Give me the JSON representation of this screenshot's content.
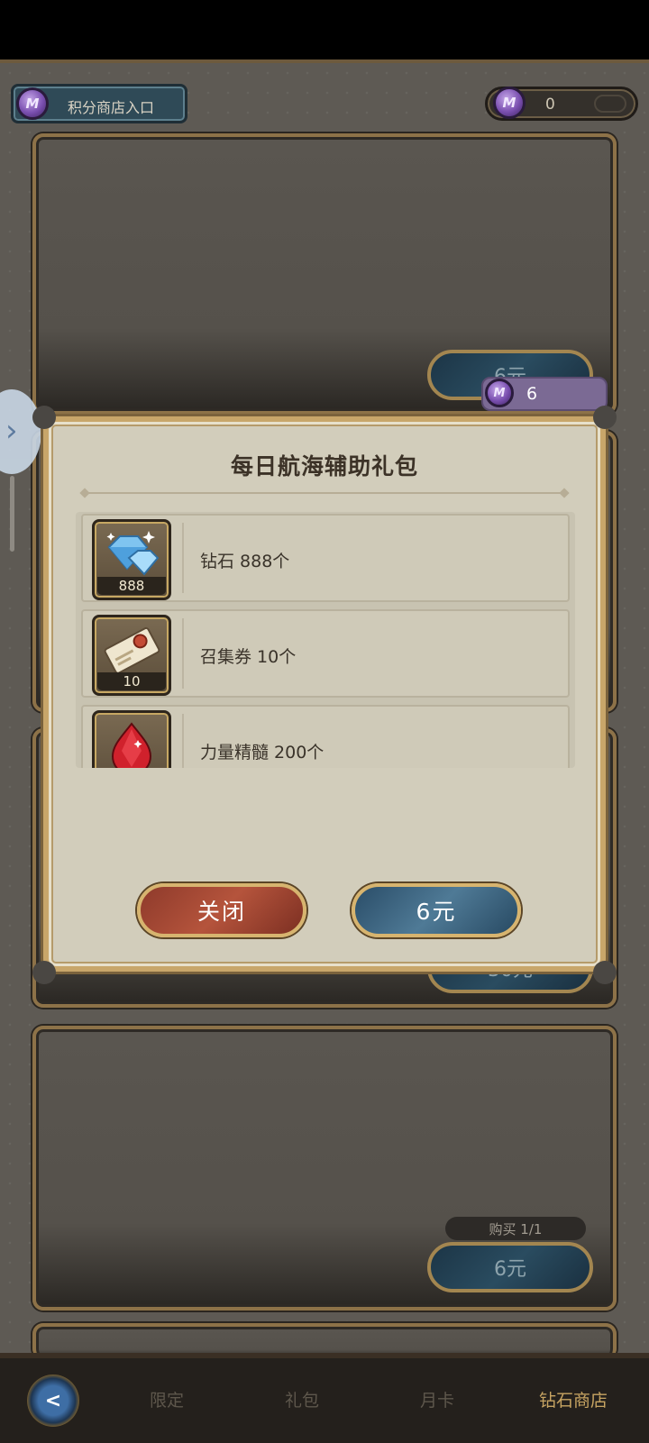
{
  "header": {
    "shop_entry_label": "积分商店入口",
    "coin_symbol": "M",
    "currency_amount": "0"
  },
  "background_cards": [
    {
      "price": "6元"
    },
    {
      "price": "30元"
    },
    {
      "purchase_limit": "购买 1/1",
      "price": "6元"
    }
  ],
  "vip_badge": {
    "value": "6"
  },
  "modal": {
    "title": "每日航海辅助礼包",
    "rewards": [
      {
        "icon": "diamond-icon",
        "qty": "888",
        "name": "钻石 888个"
      },
      {
        "icon": "summon-ticket-icon",
        "qty": "10",
        "name": "召集券 10个"
      },
      {
        "icon": "power-essence-icon",
        "qty": "",
        "name": "力量精髓 200个"
      }
    ],
    "close_label": "关闭",
    "buy_label": "6元"
  },
  "bottom_nav": {
    "tabs": [
      "限定",
      "礼包",
      "月卡",
      "钻石商店"
    ],
    "active_tab": "钻石商店",
    "back_symbol": "<"
  },
  "colors": {
    "accent_gold": "#c7a462",
    "close_red": "#b5543c",
    "buy_blue": "#4f7a96",
    "coin_purple": "#7a4fb0"
  }
}
